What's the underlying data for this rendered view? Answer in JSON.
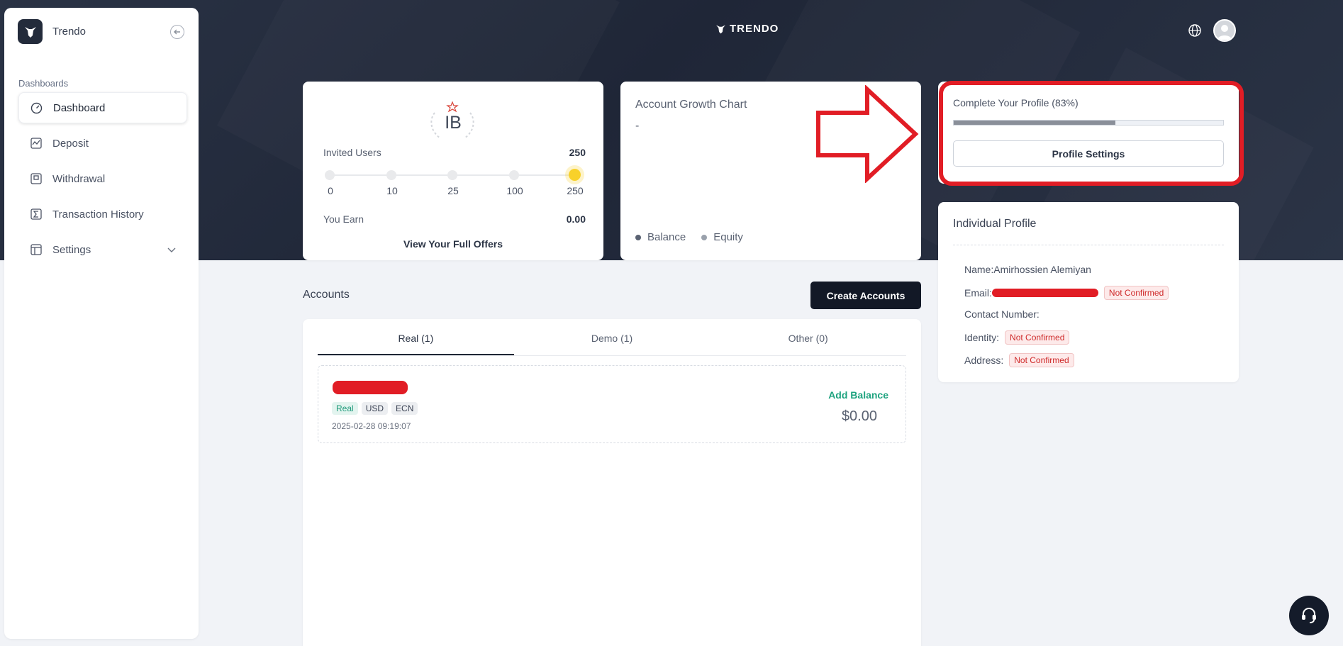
{
  "brand": {
    "name": "Trendo",
    "logo_text": "TRENDO"
  },
  "sidebar": {
    "section_label": "Dashboards",
    "items": [
      {
        "label": "Dashboard",
        "icon": "dashboard-gauge-icon",
        "active": true
      },
      {
        "label": "Deposit",
        "icon": "deposit-icon"
      },
      {
        "label": "Withdrawal",
        "icon": "withdrawal-icon"
      },
      {
        "label": "Transaction History",
        "icon": "transaction-history-icon"
      },
      {
        "label": "Settings",
        "icon": "settings-icon"
      }
    ]
  },
  "ib_card": {
    "badge": "IB",
    "invited_label": "Invited Users",
    "invited_value": "250",
    "ticks": [
      "0",
      "10",
      "25",
      "100",
      "250"
    ],
    "earn_label": "You Earn",
    "earn_value": "0.00",
    "offers_link": "View Your Full Offers"
  },
  "growth_card": {
    "title": "Account Growth Chart",
    "value": "-",
    "legend": [
      {
        "label": "Balance",
        "color": "#5a6272"
      },
      {
        "label": "Equity",
        "color": "#9aa1ac"
      }
    ]
  },
  "profile_card": {
    "title": "Complete Your Profile (83%)",
    "progress": 0.6,
    "button": "Profile Settings"
  },
  "individual_profile": {
    "title": "Individual Profile",
    "name_label": "Name:",
    "name_value": "Amirhossien Alemiyan",
    "email_label": "Email:",
    "email_status": "Not Confirmed",
    "contact_label": "Contact Number:",
    "identity_label": "Identity:",
    "identity_status": "Not Confirmed",
    "address_label": "Address:",
    "address_status": "Not Confirmed"
  },
  "accounts": {
    "title": "Accounts",
    "create_button": "Create Accounts",
    "tabs": [
      "Real (1)",
      "Demo (1)",
      "Other (0)"
    ],
    "items": [
      {
        "tags": [
          "Real",
          "USD",
          "ECN"
        ],
        "date": "2025-02-28 09:19:07",
        "action": "Add Balance",
        "amount": "$0.00"
      }
    ]
  },
  "colors": {
    "accent": "#1fa37f",
    "danger": "#e11d25",
    "dark": "#121826"
  }
}
